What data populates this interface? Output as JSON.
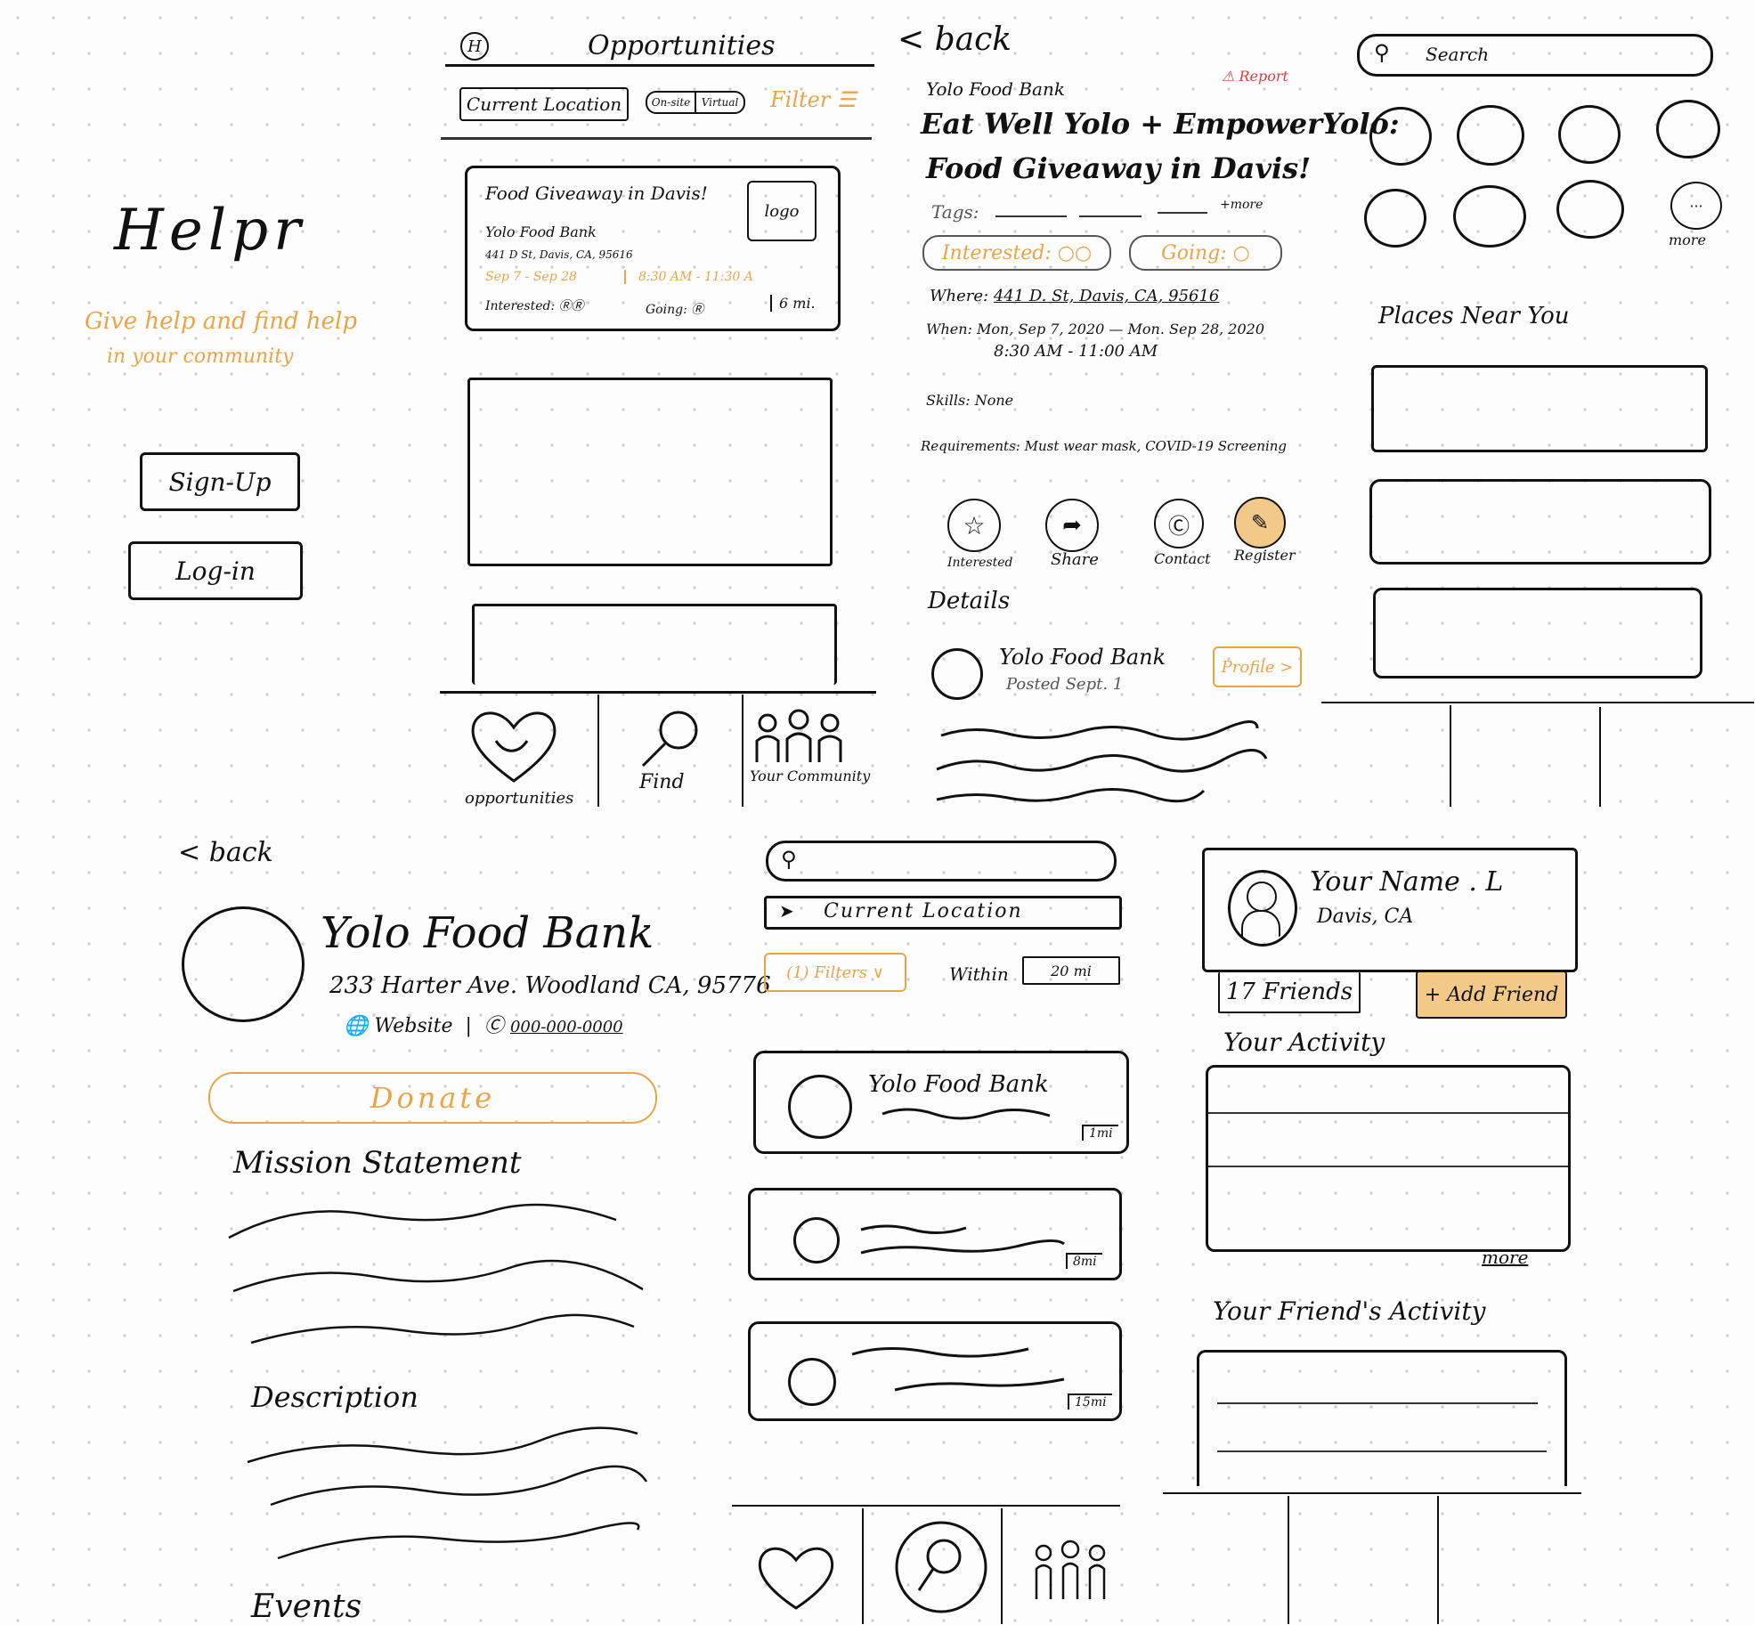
{
  "colors": {
    "accent": "#e8a548",
    "ink": "#111111",
    "report": "#d94040"
  },
  "welcome": {
    "app_title": "Helpr",
    "tagline_line1": "Give help and find help",
    "tagline_line2": "in your community",
    "signup_label": "Sign-Up",
    "login_label": "Log-in"
  },
  "opportunities": {
    "header_icon": "H",
    "title": "Opportunities",
    "location_label": "Current Location",
    "onsite_label": "On-site",
    "virtual_label": "Virtual",
    "filter_label": "Filter",
    "card": {
      "title": "Food Giveaway in Davis!",
      "org": "Yolo Food Bank",
      "address": "441 D St, Davis, CA, 95616",
      "dates": "Sep 7 - Sep 28",
      "times": "8:30 AM - 11:30 A",
      "interested_label": "Interested:",
      "going_label": "Going:",
      "distance": "6 mi.",
      "logo_label": "logo"
    },
    "nav": {
      "opportunities": "opportunities",
      "find": "Find",
      "community": "Your Community"
    }
  },
  "event_detail": {
    "back_label": "back",
    "org": "Yolo Food Bank",
    "report_label": "Report",
    "title_line1": "Eat Well Yolo + EmpowerYolo:",
    "title_line2": "Food Giveaway in Davis!",
    "tags_label": "Tags:",
    "more_label": "+more",
    "interested_label": "Interested:",
    "going_label": "Going:",
    "where_label": "Where:",
    "where_value": "441 D. St, Davis, CA, 95616",
    "when_label": "When:",
    "when_value_line1": "Mon, Sep 7, 2020 — Mon. Sep 28, 2020",
    "when_value_line2": "8:30 AM - 11:00 AM",
    "skills_label": "Skills:",
    "skills_value": "None",
    "requirements_label": "Requirements:",
    "requirements_value": "Must wear mask, COVID-19 Screening",
    "actions": [
      {
        "label": "Interested",
        "icon": "star-icon"
      },
      {
        "label": "Share",
        "icon": "share-icon"
      },
      {
        "label": "Contact",
        "icon": "contact-icon"
      },
      {
        "label": "Register",
        "icon": "register-icon"
      }
    ],
    "details_label": "Details",
    "poster_name": "Yolo Food Bank",
    "posted_label": "Posted Sept. 1",
    "profile_label": "Profile"
  },
  "find": {
    "search_placeholder": "Search",
    "more_label": "more",
    "places_label": "Places Near You"
  },
  "org_profile": {
    "back_label": "back",
    "name": "Yolo Food Bank",
    "address": "233 Harter Ave. Woodland CA, 95776",
    "website_label": "Website",
    "phone": "000-000-0000",
    "donate_label": "Donate",
    "mission_label": "Mission Statement",
    "description_label": "Description",
    "events_label": "Events"
  },
  "search_results": {
    "location_label": "Current Location",
    "filters_label": "(1) Filters",
    "within_label": "Within",
    "within_value": "20 mi",
    "results": [
      {
        "name": "Yolo Food Bank",
        "distance": "1mi"
      },
      {
        "name": "",
        "distance": "8mi"
      },
      {
        "name": "",
        "distance": "15mi"
      }
    ]
  },
  "community": {
    "user_name": "Your Name . L",
    "user_location": "Davis, CA",
    "friends_label": "17 Friends",
    "add_friend_label": "+ Add Friend",
    "your_activity_label": "Your Activity",
    "more_label": "more",
    "friends_activity_label": "Your Friend's Activity"
  }
}
